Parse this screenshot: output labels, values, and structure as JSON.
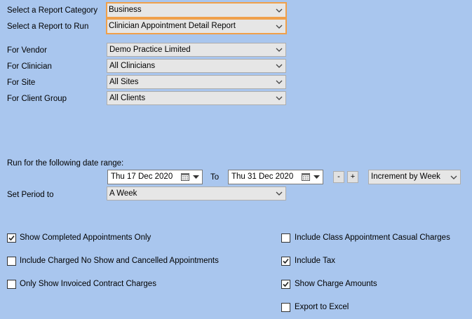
{
  "report": {
    "category_label": "Select a Report Category",
    "category_value": "Business",
    "run_label": "Select a Report to Run",
    "run_value": "Clinician Appointment Detail Report"
  },
  "filters": {
    "vendor_label": "For Vendor",
    "vendor_value": "Demo Practice Limited",
    "clinician_label": "For Clinician",
    "clinician_value": "All Clinicians",
    "site_label": "For Site",
    "site_value": "All Sites",
    "client_group_label": "For Client Group",
    "client_group_value": "All Clients"
  },
  "date_range": {
    "heading": "Run for the following date range:",
    "from_value": "Thu  17 Dec 2020",
    "to_label": "To",
    "to_value": "Thu  31 Dec 2020",
    "minus_label": "-",
    "plus_label": "+",
    "increment_value": "Increment by Week"
  },
  "period": {
    "label": "Set Period to",
    "value": "A Week"
  },
  "options": {
    "show_completed": {
      "label": "Show Completed Appointments Only",
      "checked": true
    },
    "include_no_show": {
      "label": "Include Charged No Show and Cancelled Appointments",
      "checked": false
    },
    "only_invoiced": {
      "label": "Only Show Invoiced Contract Charges",
      "checked": false
    },
    "include_class": {
      "label": "Include Class Appointment Casual Charges",
      "checked": false
    },
    "include_tax": {
      "label": "Include Tax",
      "checked": true
    },
    "show_charge": {
      "label": "Show Charge Amounts",
      "checked": true
    },
    "export_excel": {
      "label": "Export to Excel",
      "checked": false
    }
  },
  "colors": {
    "background": "#a9c6ee",
    "highlight_border": "#f0a04b",
    "combo_bg": "#e6e6e6"
  },
  "icons": {
    "combo_arrow": "chevron-down-icon",
    "calendar": "calendar-icon",
    "checkbox_checked": "check-icon"
  }
}
